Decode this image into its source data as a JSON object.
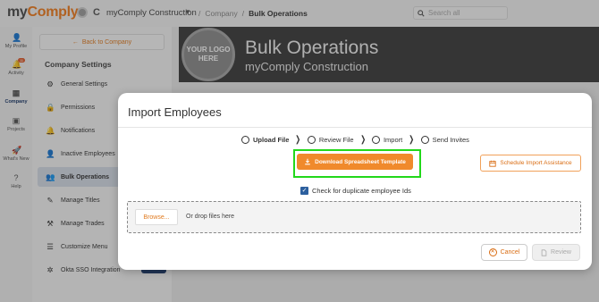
{
  "app": {
    "logo_prefix": "my",
    "logo_suffix": "Comply"
  },
  "org": {
    "name": "myComply Construction",
    "mark": "C"
  },
  "breadcrumb": {
    "parent": "Company",
    "separator": "/",
    "current": "Bulk Operations"
  },
  "search": {
    "placeholder": "Search all"
  },
  "leftnav": {
    "items": [
      {
        "label": "My Profile",
        "icon": "person-icon"
      },
      {
        "label": "Activity",
        "icon": "bell-icon",
        "badge": "11"
      },
      {
        "label": "Company",
        "icon": "building-icon",
        "active": true
      },
      {
        "label": "Projects",
        "icon": "projects-icon"
      },
      {
        "label": "What's New",
        "icon": "rocket-icon"
      },
      {
        "label": "Help",
        "icon": "help-icon"
      }
    ]
  },
  "subnav": {
    "back_label": "Back to Company",
    "title": "Company Settings",
    "items": [
      {
        "label": "General Settings",
        "icon": "gear-icon"
      },
      {
        "label": "Permissions",
        "icon": "lock-icon"
      },
      {
        "label": "Notifications",
        "icon": "bell-icon"
      },
      {
        "label": "Inactive Employees",
        "icon": "person-off-icon"
      },
      {
        "label": "Bulk Operations",
        "icon": "people-icon",
        "active": true
      },
      {
        "label": "Manage Titles",
        "icon": "pencil-icon"
      },
      {
        "label": "Manage Trades",
        "icon": "trades-icon"
      },
      {
        "label": "Customize Menu",
        "icon": "menu-icon"
      },
      {
        "label": "Okta SSO Integration",
        "icon": "okta-icon"
      }
    ]
  },
  "banner": {
    "logo_line1": "YOUR LOGO",
    "logo_line2": "HERE",
    "title": "Bulk Operations",
    "subtitle": "myComply Construction"
  },
  "modal": {
    "title": "Import Employees",
    "steps": [
      {
        "label": "Upload File",
        "current": true
      },
      {
        "label": "Review File"
      },
      {
        "label": "Import"
      },
      {
        "label": "Send Invites"
      }
    ],
    "download_label": "Download Spreadsheet Template",
    "assistance_label": "Schedule Import Assistance",
    "duplicate_check_label": "Check for duplicate employee Ids",
    "duplicate_check_checked": true,
    "browse_label": "Browse...",
    "drop_text": "Or drop files here",
    "cancel_label": "Cancel",
    "review_label": "Review"
  },
  "colors": {
    "accent": "#f08a2c",
    "highlight": "#22d81a",
    "navy": "#1d3a6b"
  }
}
